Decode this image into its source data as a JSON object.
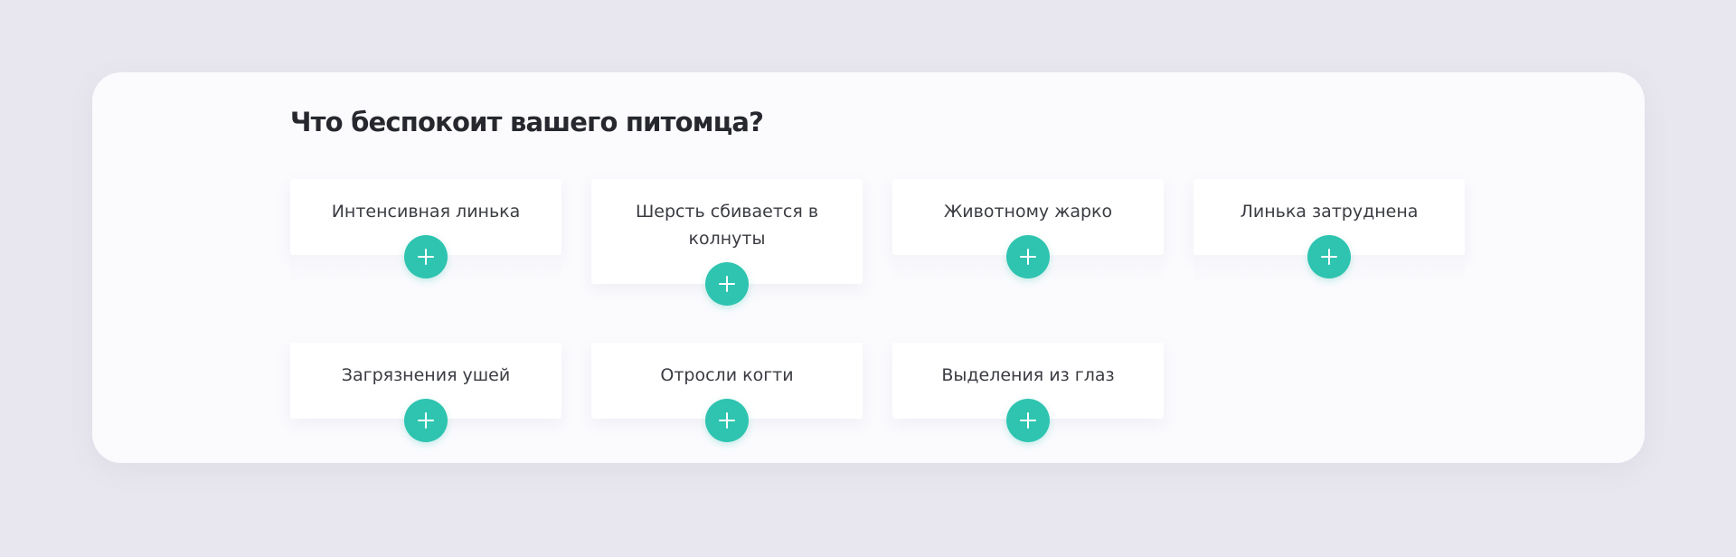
{
  "section": {
    "title": "Что беспокоит вашего питомца?"
  },
  "cards": [
    {
      "label": "Интенсивная линька",
      "action_icon": "plus-icon"
    },
    {
      "label": "Шерсть сбивается в колнуты",
      "action_icon": "plus-icon"
    },
    {
      "label": "Животному жарко",
      "action_icon": "plus-icon"
    },
    {
      "label": "Линька затруднена",
      "action_icon": "plus-icon"
    },
    {
      "label": "Загрязнения ушей",
      "action_icon": "plus-icon"
    },
    {
      "label": "Отросли когти",
      "action_icon": "plus-icon"
    },
    {
      "label": "Выделения из глаз",
      "action_icon": "plus-icon"
    }
  ],
  "colors": {
    "page_background": "#e8e7ef",
    "panel_background": "#fbfbfe",
    "card_background": "#ffffff",
    "accent": "#2ec4b0",
    "title_text": "#26282e",
    "card_text": "#3a3c42"
  }
}
